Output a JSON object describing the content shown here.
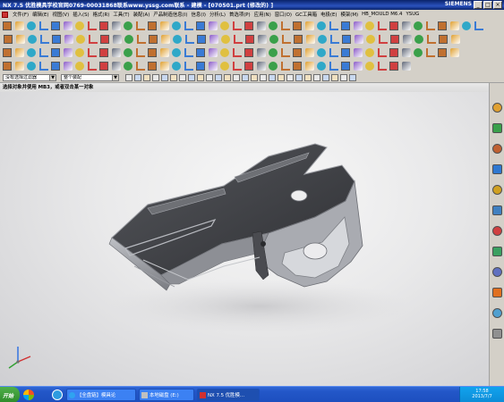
{
  "window": {
    "title": "NX 7.5 优胜模具学校官网0769-00031868联系www.yssg.com联系 - 建模 - [070501.prt (修改的) ]",
    "brand": "SIEMENS",
    "controls": {
      "minimize": "_",
      "maximize": "□",
      "close": "×"
    }
  },
  "menu": {
    "items": [
      "文件(F)",
      "编辑(E)",
      "视图(V)",
      "插入(S)",
      "格式(R)",
      "工具(T)",
      "装配(A)",
      "产品制造信息(I)",
      "信息(I)",
      "分析(L)",
      "首选项(P)",
      "应用(N)",
      "窗口(O)",
      "GC工具箱",
      "电极(E)",
      "模架(M)",
      "HB_MOULD M6.4",
      "YSUG"
    ]
  },
  "selection_bar": {
    "filter_value": "没有选择过滤器",
    "scope_value": "整个装配"
  },
  "cue_line": "选择对象并使用 MB3，或者双击某一对象",
  "taskbar": {
    "start_label": "开始",
    "tasks": [
      "【全盘链】模具论",
      "本地磁盘 (E:)",
      "NX 7.5 优胜模..."
    ],
    "clock_time": "17:58",
    "clock_date": "2013/7/7"
  },
  "icons": {
    "toolbar": [
      "new-icon",
      "open-icon",
      "save-icon",
      "undo-icon",
      "redo-icon",
      "cut-icon",
      "copy-icon",
      "paste-icon",
      "delete-icon",
      "sketch-icon",
      "extrude-icon",
      "revolve-icon",
      "hole-icon",
      "boss-icon",
      "pocket-icon",
      "blend-icon",
      "chamfer-icon",
      "shell-icon",
      "trim-icon",
      "fit-icon",
      "zoom-icon",
      "rotate-icon",
      "pan-icon",
      "shaded-icon",
      "wireframe-icon",
      "layer-icon",
      "measure-icon"
    ],
    "resource_bar": [
      "assembly-navigator-icon",
      "constraint-navigator-icon",
      "part-navigator-icon",
      "reuse-library-icon",
      "history-icon",
      "system-materials-icon",
      "process-studio-icon",
      "roles-icon",
      "web-browser-icon"
    ]
  },
  "colors": {
    "titlebar": "#0a246a",
    "chrome": "#d4d0c8",
    "viewport_center": "#f8f8f8",
    "viewport_edge": "#cfcfd2",
    "taskbar": "#2357c8",
    "part_dark": "#3a3b3f",
    "part_edge": "#9a9ca2"
  }
}
